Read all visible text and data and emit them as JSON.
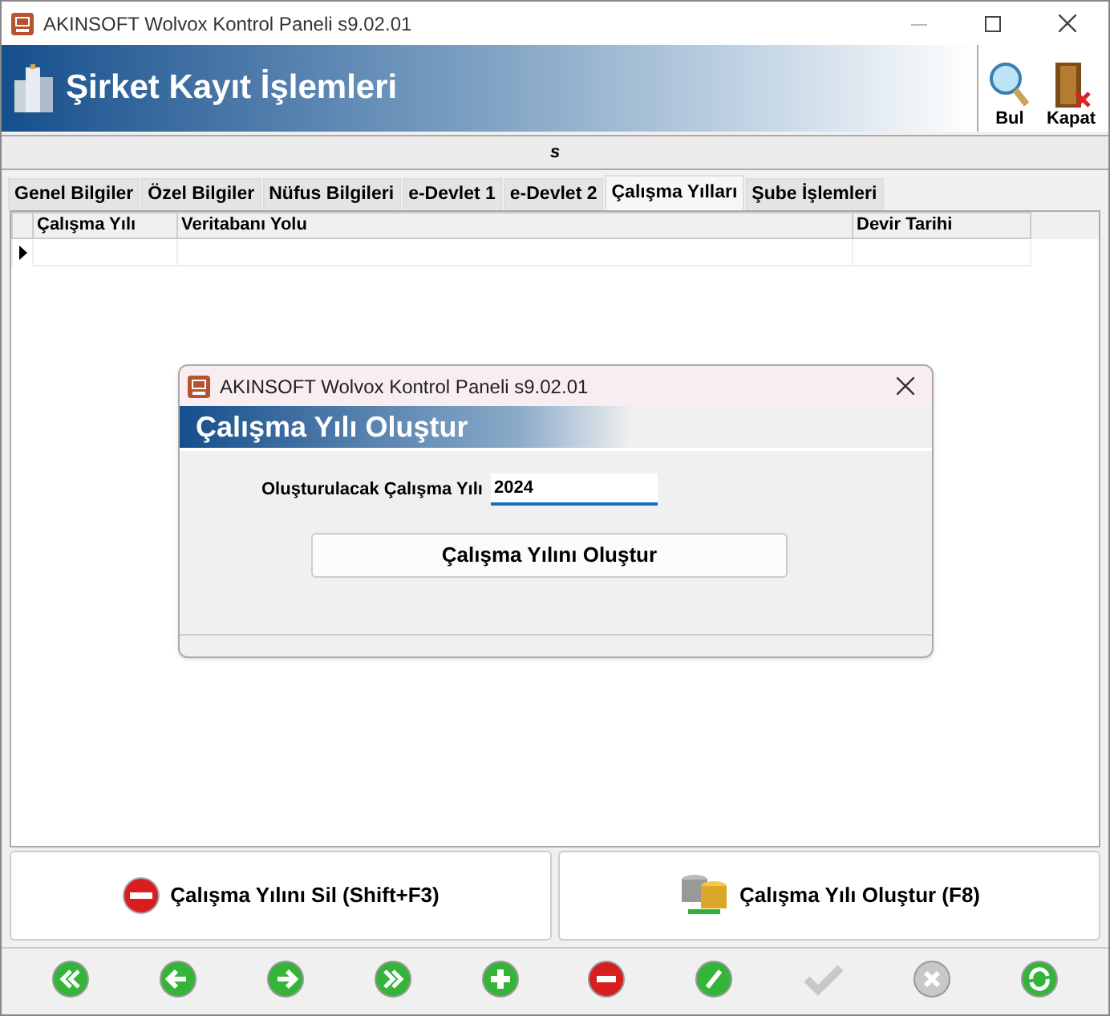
{
  "window": {
    "title": "AKINSOFT Wolvox Kontrol Paneli s9.02.01"
  },
  "header": {
    "title": "Şirket Kayıt İşlemleri",
    "tools": [
      {
        "kind": "search",
        "label": "Bul"
      },
      {
        "kind": "exit",
        "label": "Kapat"
      }
    ]
  },
  "toolbar": {
    "label": "s"
  },
  "tabs": [
    {
      "label": "Genel Bilgiler",
      "selected": false
    },
    {
      "label": "Özel Bilgiler",
      "selected": false
    },
    {
      "label": "Nüfus Bilgileri",
      "selected": false
    },
    {
      "label": "e-Devlet 1",
      "selected": false
    },
    {
      "label": "e-Devlet 2",
      "selected": false
    },
    {
      "label": "Çalışma Yılları",
      "selected": true
    },
    {
      "label": "Şube İşlemleri",
      "selected": false
    }
  ],
  "table": {
    "columns": [
      "Çalışma Yılı",
      "Veritabanı Yolu",
      "Devir Tarihi"
    ]
  },
  "dialog": {
    "title": "AKINSOFT Wolvox Kontrol Paneli s9.02.01",
    "heading": "Çalışma Yılı Oluştur",
    "field": {
      "label": "Oluşturulacak Çalışma Yılı",
      "value": "2024"
    },
    "button": "Çalışma Yılını Oluştur"
  },
  "actions": [
    {
      "kind": "delete",
      "label": "Çalışma Yılını Sil (Shift+F3)"
    },
    {
      "kind": "create",
      "label": "Çalışma Yılı Oluştur (F8)"
    }
  ],
  "navigation": [
    {
      "kind": "first",
      "disabled": false
    },
    {
      "kind": "prev",
      "disabled": false
    },
    {
      "kind": "next",
      "disabled": false
    },
    {
      "kind": "last",
      "disabled": false
    },
    {
      "kind": "add",
      "disabled": false
    },
    {
      "kind": "remove",
      "disabled": false
    },
    {
      "kind": "edit",
      "disabled": false
    },
    {
      "kind": "confirm",
      "disabled": true
    },
    {
      "kind": "cancel",
      "disabled": true
    },
    {
      "kind": "refresh",
      "disabled": false
    }
  ]
}
